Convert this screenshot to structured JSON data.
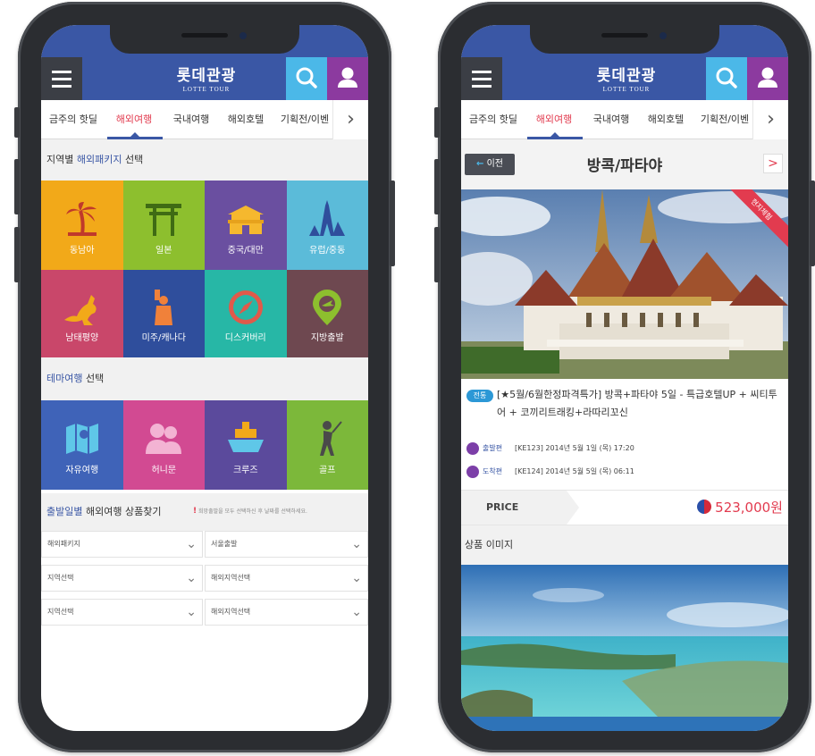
{
  "left_screen": {
    "app": {
      "logo_ko": "롯데관광",
      "logo_en": "LOTTE TOUR"
    },
    "tabs": [
      {
        "label": "금주의 핫딜"
      },
      {
        "label": "해외여행"
      },
      {
        "label": "국내여행"
      },
      {
        "label": "해외호텔"
      },
      {
        "label": "기획전/이벤"
      }
    ],
    "region_section": {
      "prefix": "지역별",
      "highlight": "해외패키지",
      "suffix": "선택"
    },
    "regions": [
      {
        "label": "동남아",
        "color": "#f2a919",
        "icon": "palm-tree-icon"
      },
      {
        "label": "일본",
        "color": "#8dbf2e",
        "icon": "torii-gate-icon"
      },
      {
        "label": "중국/대만",
        "color": "#6a4fa0",
        "icon": "chinese-palace-icon"
      },
      {
        "label": "유럽/중동",
        "color": "#5bbbd9",
        "icon": "eiffel-tower-icon"
      },
      {
        "label": "남태평양",
        "color": "#c9476a",
        "icon": "kangaroo-icon"
      },
      {
        "label": "미주/캐나다",
        "color": "#2f4e9c",
        "icon": "statue-of-liberty-icon"
      },
      {
        "label": "디스커버리",
        "color": "#27b7a6",
        "icon": "compass-icon"
      },
      {
        "label": "지방출발",
        "color": "#6e4850",
        "icon": "plane-pin-icon"
      }
    ],
    "theme_section": {
      "highlight": "테마여행",
      "suffix": "선택"
    },
    "themes": [
      {
        "label": "자유여행",
        "color": "#3f63b8",
        "icon": "map-icon"
      },
      {
        "label": "허니문",
        "color": "#d24a92",
        "icon": "couple-icon"
      },
      {
        "label": "크루즈",
        "color": "#5b4a9c",
        "icon": "cruise-ship-icon"
      },
      {
        "label": "골프",
        "color": "#7cb83a",
        "icon": "golfer-icon"
      }
    ],
    "finder": {
      "highlight": "출발일별",
      "title": "해외여행 상품찾기",
      "note_mark": "!",
      "note": "희망출발을 모두 선택하신 후 날짜를 선택하세요.",
      "selects": [
        {
          "value": "해외패키지"
        },
        {
          "value": "서울출발"
        },
        {
          "value": "지역선택"
        },
        {
          "value": "해외지역선택"
        },
        {
          "value": "지역선택"
        },
        {
          "value": "해외지역선택"
        }
      ]
    }
  },
  "right_screen": {
    "app": {
      "logo_ko": "롯데관광",
      "logo_en": "LOTTE TOUR"
    },
    "tabs": [
      {
        "label": "금주의 핫딜"
      },
      {
        "label": "해외여행"
      },
      {
        "label": "국내여행"
      },
      {
        "label": "해외호텔"
      },
      {
        "label": "기획전/이벤"
      }
    ],
    "back_label": "이전",
    "page_title": "방콕/파타야",
    "ribbon": "현지체험",
    "product": {
      "badge": "전통",
      "name": "[★5월/6월한정파격특가] 방콕+파타야 5일 - 특급호텔UP + 씨티투어 + 코끼리트래킹+라따리꼬신"
    },
    "departure": {
      "label": "출발편",
      "text": "[KE123] 2014년 5월 1일 (목) 17:20"
    },
    "arrival": {
      "label": "도착편",
      "text": "[KE124] 2014년 5월 5일 (목) 06:11"
    },
    "price": {
      "label": "PRICE",
      "value": "523,000원"
    },
    "images_heading": "상품 이미지"
  }
}
